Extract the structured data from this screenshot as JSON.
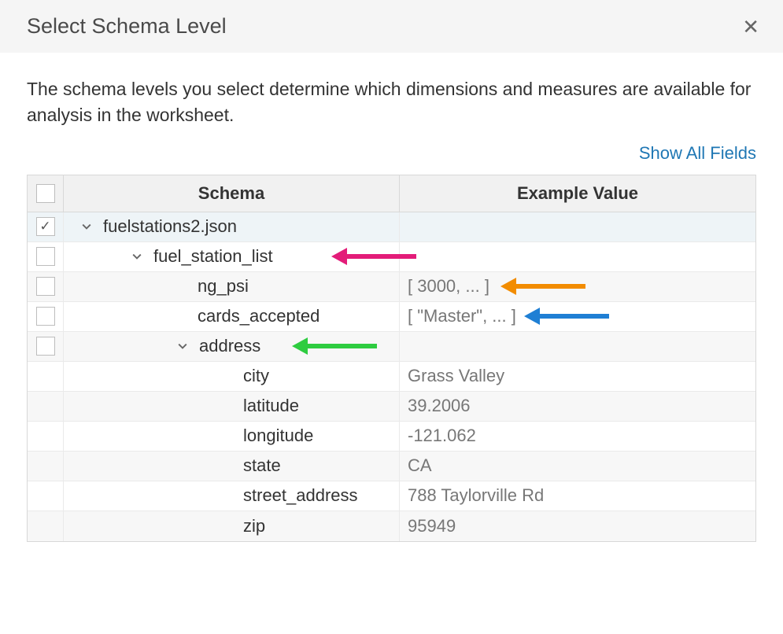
{
  "title": "Select Schema Level",
  "description": "The schema levels you select determine which dimensions and measures are available for analysis in the worksheet.",
  "link": "Show All Fields",
  "headers": {
    "schema": "Schema",
    "example": "Example Value"
  },
  "rows": [
    {
      "label": "fuelstations2.json",
      "example": "",
      "checked": true,
      "hasCheckbox": true,
      "expandable": true
    },
    {
      "label": "fuel_station_list",
      "example": "",
      "checked": false,
      "hasCheckbox": true,
      "expandable": true
    },
    {
      "label": "ng_psi",
      "example": "[ 3000, ... ]",
      "checked": false,
      "hasCheckbox": true,
      "expandable": false
    },
    {
      "label": "cards_accepted",
      "example": "[ \"Master\", ... ]",
      "checked": false,
      "hasCheckbox": true,
      "expandable": false
    },
    {
      "label": "address",
      "example": "",
      "checked": false,
      "hasCheckbox": true,
      "expandable": true
    },
    {
      "label": "city",
      "example": "Grass Valley",
      "checked": false,
      "hasCheckbox": false,
      "expandable": false
    },
    {
      "label": "latitude",
      "example": "39.2006",
      "checked": false,
      "hasCheckbox": false,
      "expandable": false
    },
    {
      "label": "longitude",
      "example": "-121.062",
      "checked": false,
      "hasCheckbox": false,
      "expandable": false
    },
    {
      "label": "state",
      "example": "CA",
      "checked": false,
      "hasCheckbox": false,
      "expandable": false
    },
    {
      "label": "street_address",
      "example": "788 Taylorville Rd",
      "checked": false,
      "hasCheckbox": false,
      "expandable": false
    },
    {
      "label": "zip",
      "example": "95949",
      "checked": false,
      "hasCheckbox": false,
      "expandable": false
    }
  ]
}
